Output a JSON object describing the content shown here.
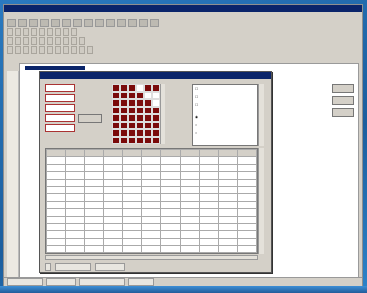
{
  "app": {
    "title": "",
    "menu": [
      "",
      "",
      "",
      "",
      "",
      "",
      "",
      ""
    ]
  },
  "toolbar_rows": [
    {
      "buttons": 14
    },
    {
      "labels": [
        "",
        "",
        "",
        "",
        "",
        "",
        "",
        "",
        ""
      ]
    },
    {
      "labels": [
        "",
        "",
        "",
        "",
        "",
        "",
        "",
        "",
        "",
        ""
      ]
    },
    {
      "labels": [
        "",
        "",
        "",
        "",
        "",
        "",
        "",
        "",
        "",
        "",
        ""
      ]
    }
  ],
  "dialog": {
    "title": "",
    "fields": [
      "",
      "",
      "",
      "",
      ""
    ],
    "field_values": [
      "",
      "",
      ""
    ],
    "checkboxes": [
      "",
      "",
      ""
    ],
    "radios": [
      "",
      "",
      ""
    ],
    "table": {
      "headers": [
        "",
        "",
        "",
        "",
        "",
        "",
        "",
        "",
        "",
        "",
        ""
      ],
      "rows": [
        [
          "",
          "",
          "",
          "",
          "",
          "",
          "",
          "",
          "",
          "",
          ""
        ],
        [
          "",
          "",
          "",
          "",
          "",
          "",
          "",
          "",
          "",
          "",
          ""
        ],
        [
          "",
          "",
          "",
          "",
          "",
          "",
          "",
          "",
          "",
          "",
          ""
        ],
        [
          "",
          "",
          "",
          "",
          "",
          "",
          "",
          "",
          "",
          "",
          ""
        ],
        [
          "",
          "",
          "",
          "",
          "",
          "",
          "",
          "",
          "",
          "",
          ""
        ],
        [
          "",
          "",
          "",
          "",
          "",
          "",
          "",
          "",
          "",
          "",
          ""
        ],
        [
          "",
          "",
          "",
          "",
          "",
          "",
          "",
          "",
          "",
          "",
          ""
        ],
        [
          "",
          "",
          "",
          "",
          "",
          "",
          "",
          "",
          "",
          "",
          ""
        ],
        [
          "",
          "",
          "",
          "",
          "",
          "",
          "",
          "",
          "",
          "",
          ""
        ],
        [
          "",
          "",
          "",
          "",
          "",
          "",
          "",
          "",
          "",
          "",
          ""
        ],
        [
          "",
          "",
          "",
          "",
          "",
          "",
          "",
          "",
          "",
          "",
          ""
        ],
        [
          "",
          "",
          "",
          "",
          "",
          "",
          "",
          "",
          "",
          "",
          ""
        ],
        [
          "",
          "",
          "",
          "",
          "",
          "",
          "",
          "",
          "",
          "",
          ""
        ],
        [
          "",
          "",
          "",
          "",
          "",
          "",
          "",
          "",
          "",
          "",
          ""
        ],
        [
          "",
          "",
          "",
          "",
          "",
          "",
          "",
          "",
          "",
          "",
          ""
        ],
        [
          "",
          "",
          "",
          "",
          "",
          "",
          "",
          "",
          "",
          "",
          ""
        ]
      ]
    },
    "bottom_labels": [
      "",
      "",
      ""
    ]
  },
  "statusbar": [
    "",
    "",
    "",
    ""
  ],
  "colors": {
    "titlebar": "#0a246a",
    "chrome": "#d4d0c8",
    "desktop": "#1f6fb5",
    "grid_fill": "#7a0a0a",
    "highlight_text": "#a00000"
  }
}
